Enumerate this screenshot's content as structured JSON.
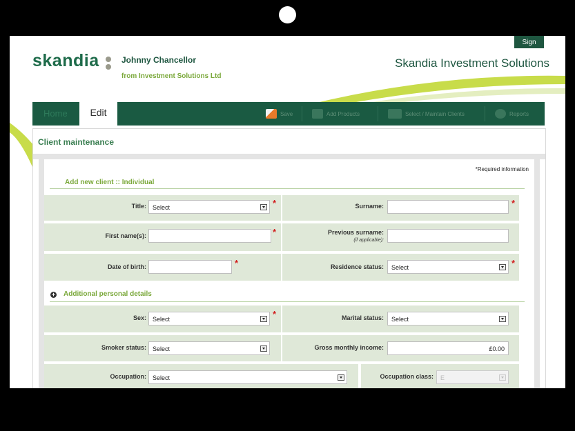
{
  "header": {
    "sign_out": "Sign out",
    "logo": "skandia",
    "user_name": "Johnny Chancellor",
    "user_company": "from Investment Solutions Ltd",
    "brand": "Skandia Investment Solutions"
  },
  "nav": {
    "home": "Home",
    "edit": "Edit",
    "actions": [
      "Save",
      "Add Products",
      "Select / Maintain Clients",
      "Reports"
    ]
  },
  "panel": {
    "title": "Client maintenance",
    "required_info": "*Required information",
    "section_new": "Add new client :: Individual",
    "section_additional": "Additional personal details"
  },
  "form": {
    "title_label": "Title:",
    "title_value": "Select",
    "surname_label": "Surname:",
    "surname_value": "",
    "first_name_label": "First name(s):",
    "first_name_value": "",
    "previous_surname_label": "Previous surname:",
    "previous_surname_note": "(if applicable):",
    "previous_surname_value": "",
    "dob_label": "Date of birth:",
    "dob_value": "",
    "residence_label": "Residence status:",
    "residence_value": "Select",
    "sex_label": "Sex:",
    "sex_value": "Select",
    "marital_label": "Marital status:",
    "marital_value": "Select",
    "smoker_label": "Smoker status:",
    "smoker_value": "Select",
    "income_label": "Gross monthly income:",
    "income_value": "£0.00",
    "occupation_label": "Occupation:",
    "occupation_value": "Select",
    "occupation_class_label": "Occupation class:",
    "occupation_class_value": "E",
    "required_mark": "*"
  },
  "colors": {
    "brand_green": "#1e5640",
    "accent_green": "#7aa83a",
    "row_background": "#dfe8d8",
    "required_red": "#d21f1f"
  }
}
